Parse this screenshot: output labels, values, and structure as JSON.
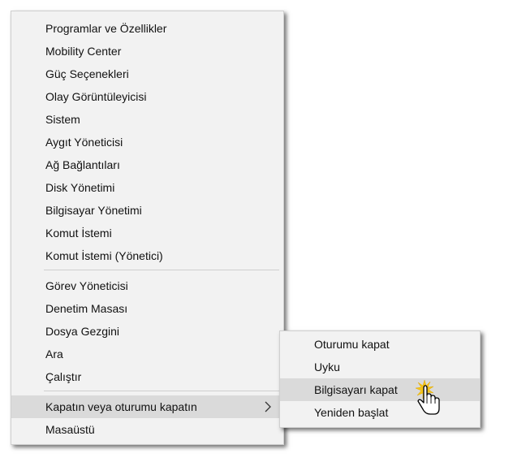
{
  "menu": {
    "group1": [
      "Programlar ve Özellikler",
      "Mobility Center",
      "Güç Seçenekleri",
      "Olay Görüntüleyicisi",
      "Sistem",
      "Aygıt Yöneticisi",
      "Ağ Bağlantıları",
      "Disk Yönetimi",
      "Bilgisayar Yönetimi",
      "Komut İstemi",
      "Komut İstemi (Yönetici)"
    ],
    "group2": [
      "Görev Yöneticisi",
      "Denetim Masası",
      "Dosya Gezgini",
      "Ara",
      "Çalıştır"
    ],
    "shutdown": "Kapatın veya oturumu kapatın",
    "desktop": "Masaüstü"
  },
  "submenu": {
    "items": [
      "Oturumu kapat",
      "Uyku",
      "Bilgisayarı kapat",
      "Yeniden başlat"
    ],
    "highlighted": "Bilgisayarı kapat"
  },
  "icons": {
    "submenu_arrow": "chevron-right-icon",
    "cursor": "hand-pointer-icon"
  },
  "colors": {
    "menu_bg": "#f2f2f2",
    "highlight_bg": "#dadada",
    "separator": "#cfcfcf",
    "text": "#111111",
    "cursor_glow": "#f5c518"
  }
}
